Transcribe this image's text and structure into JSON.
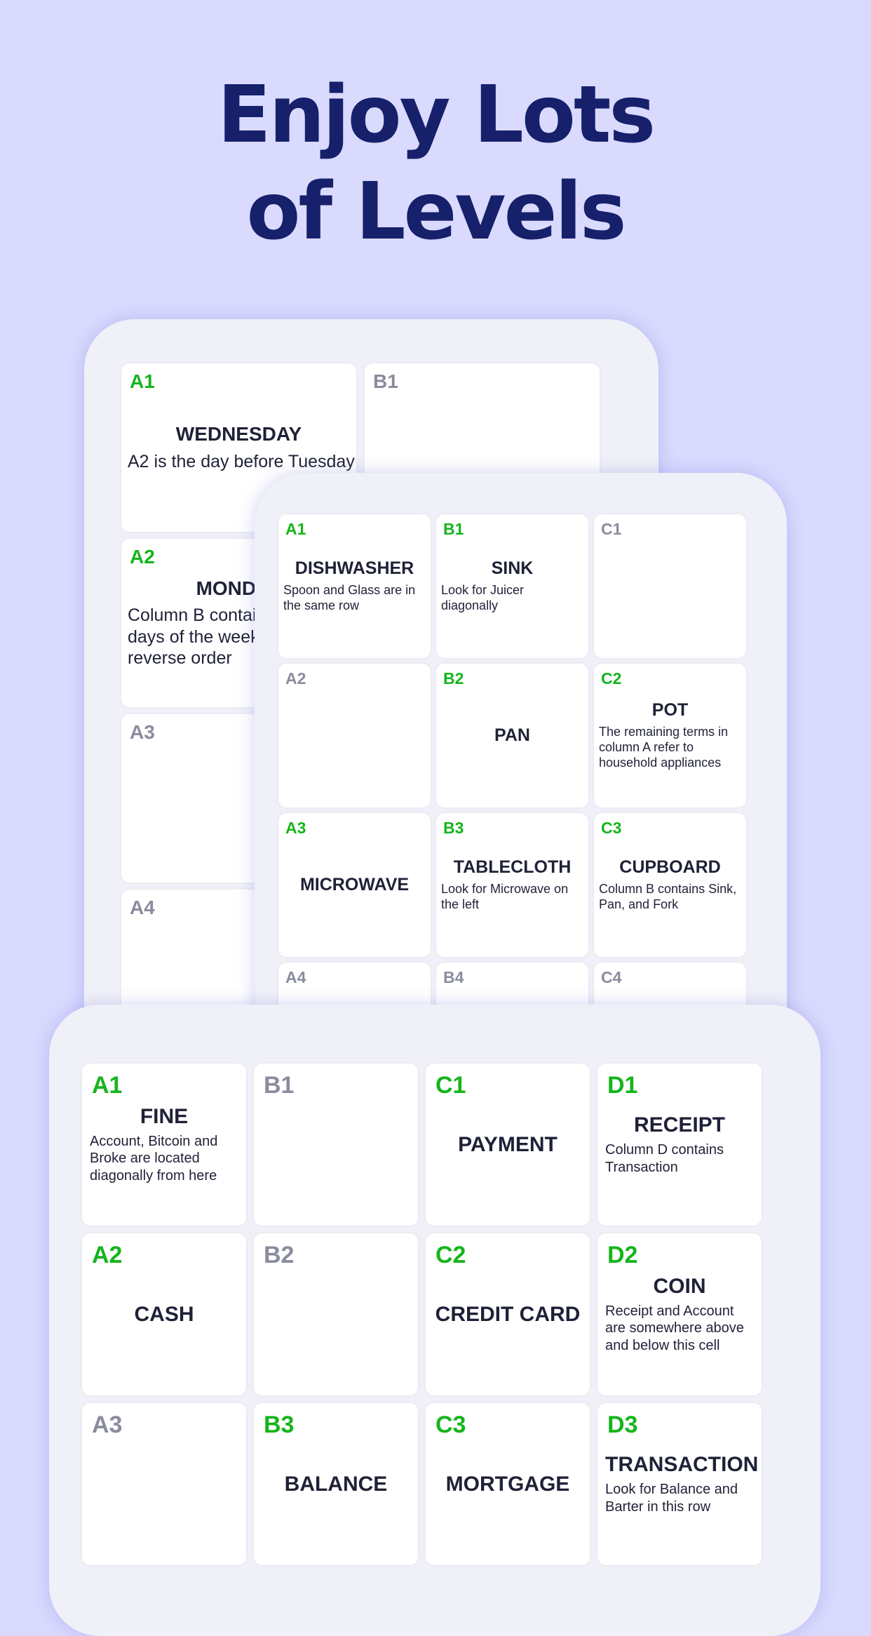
{
  "title": {
    "line1": "Enjoy Lots",
    "line2": "of Levels"
  },
  "colors": {
    "background": "#d9dafe",
    "title": "#16206b",
    "solved_label": "#15b51b",
    "unsolved_label": "#8a8c9e",
    "word": "#1f2137"
  },
  "panels": [
    {
      "name": "puzzle-back",
      "cells": [
        {
          "label": "A1",
          "status": "green",
          "word": "WEDNESDAY",
          "clue": "A2 is the day before Tuesday"
        },
        {
          "label": "B1",
          "status": "gray"
        },
        {
          "label": "A2",
          "status": "green",
          "word": "MONDAY",
          "clue": "Column B contains the days of the week in reverse order"
        },
        {
          "label": "A3",
          "status": "gray"
        },
        {
          "label": "A4",
          "status": "gray"
        }
      ]
    },
    {
      "name": "puzzle-middle",
      "cells": [
        {
          "label": "A1",
          "status": "green",
          "word": "DISHWASHER",
          "clue": "Spoon and Glass are in the same row"
        },
        {
          "label": "B1",
          "status": "green",
          "word": "SINK",
          "clue": "Look for Juicer diagonally"
        },
        {
          "label": "C1",
          "status": "gray"
        },
        {
          "label": "A2",
          "status": "gray"
        },
        {
          "label": "B2",
          "status": "green",
          "word": "PAN"
        },
        {
          "label": "C2",
          "status": "green",
          "word": "POT",
          "clue": "The remaining terms in column A refer to household appliances"
        },
        {
          "label": "A3",
          "status": "green",
          "word": "MICROWAVE"
        },
        {
          "label": "B3",
          "status": "green",
          "word": "TABLECLOTH",
          "clue": "Look for Microwave on the left"
        },
        {
          "label": "C3",
          "status": "green",
          "word": "CUPBOARD",
          "clue": "Column B contains Sink, Pan, and Fork"
        },
        {
          "label": "A4",
          "status": "gray"
        },
        {
          "label": "B4",
          "status": "gray"
        },
        {
          "label": "C4",
          "status": "gray"
        }
      ]
    },
    {
      "name": "puzzle-front",
      "cells": [
        {
          "label": "A1",
          "status": "green",
          "word": "FINE",
          "clue": "Account, Bitcoin and Broke are located diagonally from here"
        },
        {
          "label": "B1",
          "status": "gray"
        },
        {
          "label": "C1",
          "status": "green",
          "word": "PAYMENT"
        },
        {
          "label": "D1",
          "status": "green",
          "word": "RECEIPT",
          "clue": "Column D contains Transaction"
        },
        {
          "label": "A2",
          "status": "green",
          "word": "CASH"
        },
        {
          "label": "B2",
          "status": "gray"
        },
        {
          "label": "C2",
          "status": "green",
          "word": "CREDIT CARD"
        },
        {
          "label": "D2",
          "status": "green",
          "word": "COIN",
          "clue": "Receipt and Account are somewhere above and below this cell"
        },
        {
          "label": "A3",
          "status": "gray"
        },
        {
          "label": "B3",
          "status": "green",
          "word": "BALANCE"
        },
        {
          "label": "C3",
          "status": "green",
          "word": "MORTGAGE"
        },
        {
          "label": "D3",
          "status": "green",
          "word": "TRANSACTION",
          "clue": "Look for Balance and Barter in this row"
        }
      ]
    }
  ]
}
